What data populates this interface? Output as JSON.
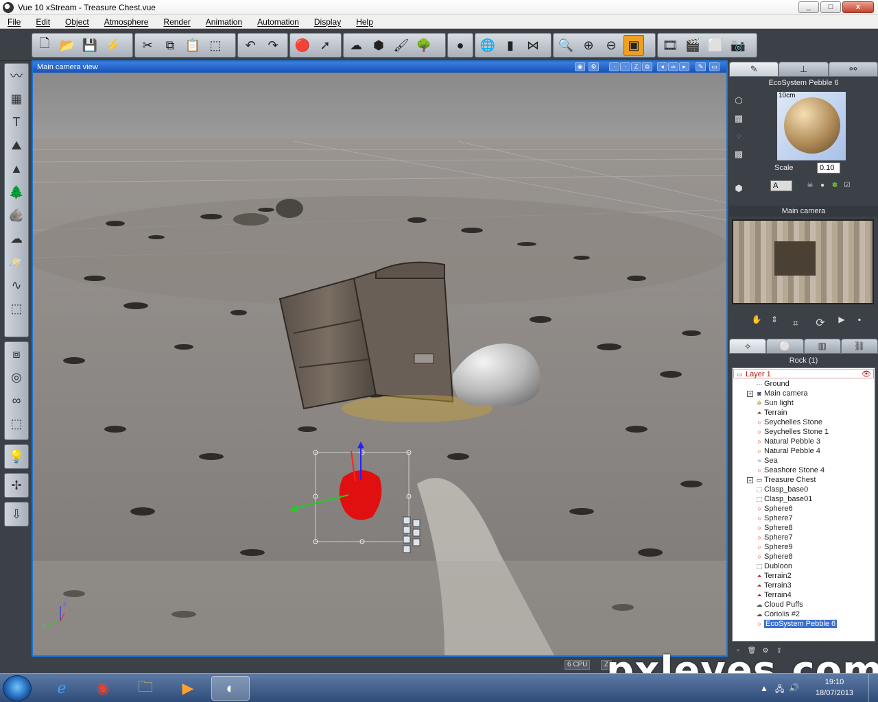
{
  "window": {
    "title": "Vue 10 xStream - Treasure Chest.vue",
    "min": "_",
    "max": "□",
    "close": "x"
  },
  "menu": [
    "File",
    "Edit",
    "Object",
    "Atmosphere",
    "Render",
    "Animation",
    "Automation",
    "Display",
    "Help"
  ],
  "viewport": {
    "title": "Main camera view",
    "cpu": "6 CPU",
    "status_extra": "Z"
  },
  "material": {
    "name": "EcoSystem Pebble 6",
    "size_label": "10cm",
    "scale_label": "Scale",
    "scale_value": "0.10",
    "mode": "A"
  },
  "camera_panel": {
    "title": "Main camera"
  },
  "objects_panel": {
    "title": "Rock (1)"
  },
  "layer": {
    "name": "Layer 1"
  },
  "tree": [
    {
      "label": "Ground",
      "icon": "ground"
    },
    {
      "label": "Main camera",
      "icon": "camera",
      "expand": true
    },
    {
      "label": "Sun light",
      "icon": "sun"
    },
    {
      "label": "Terrain",
      "icon": "terrain"
    },
    {
      "label": "Seychelles Stone",
      "icon": "rock"
    },
    {
      "label": "Seychelles Stone 1",
      "icon": "rock"
    },
    {
      "label": "Natural Pebble 3",
      "icon": "rock"
    },
    {
      "label": "Natural Pebble 4",
      "icon": "rock"
    },
    {
      "label": "Sea",
      "icon": "water"
    },
    {
      "label": "Seashore Stone 4",
      "icon": "rock"
    },
    {
      "label": "Treasure Chest",
      "icon": "group",
      "expand": true
    },
    {
      "label": "Clasp_base0",
      "icon": "object"
    },
    {
      "label": "Clasp_base01",
      "icon": "object"
    },
    {
      "label": "Sphere6",
      "icon": "sphere"
    },
    {
      "label": "Sphere7",
      "icon": "sphere"
    },
    {
      "label": "Sphere8",
      "icon": "sphere"
    },
    {
      "label": "Sphere7",
      "icon": "sphere"
    },
    {
      "label": "Sphere9",
      "icon": "sphere"
    },
    {
      "label": "Sphere8",
      "icon": "sphere"
    },
    {
      "label": "Dubloon",
      "icon": "object"
    },
    {
      "label": "Terrain2",
      "icon": "terrain"
    },
    {
      "label": "Terrain3",
      "icon": "terrain"
    },
    {
      "label": "Terrain4",
      "icon": "terrain"
    },
    {
      "label": "Cloud Puffs",
      "icon": "cloud"
    },
    {
      "label": "Coriolis #2",
      "icon": "cloud"
    },
    {
      "label": "EcoSystem Pebble 6",
      "icon": "rock",
      "selected": true
    }
  ],
  "taskbar": {
    "time": "19:10",
    "date": "18/07/2013"
  },
  "watermark": "pxleyes.com",
  "colors": {
    "viewport_border": "#1a73d8",
    "selection_red": "#e01010",
    "panel_bg": "#3c4148",
    "tree_selected": "#3b6fcf"
  }
}
